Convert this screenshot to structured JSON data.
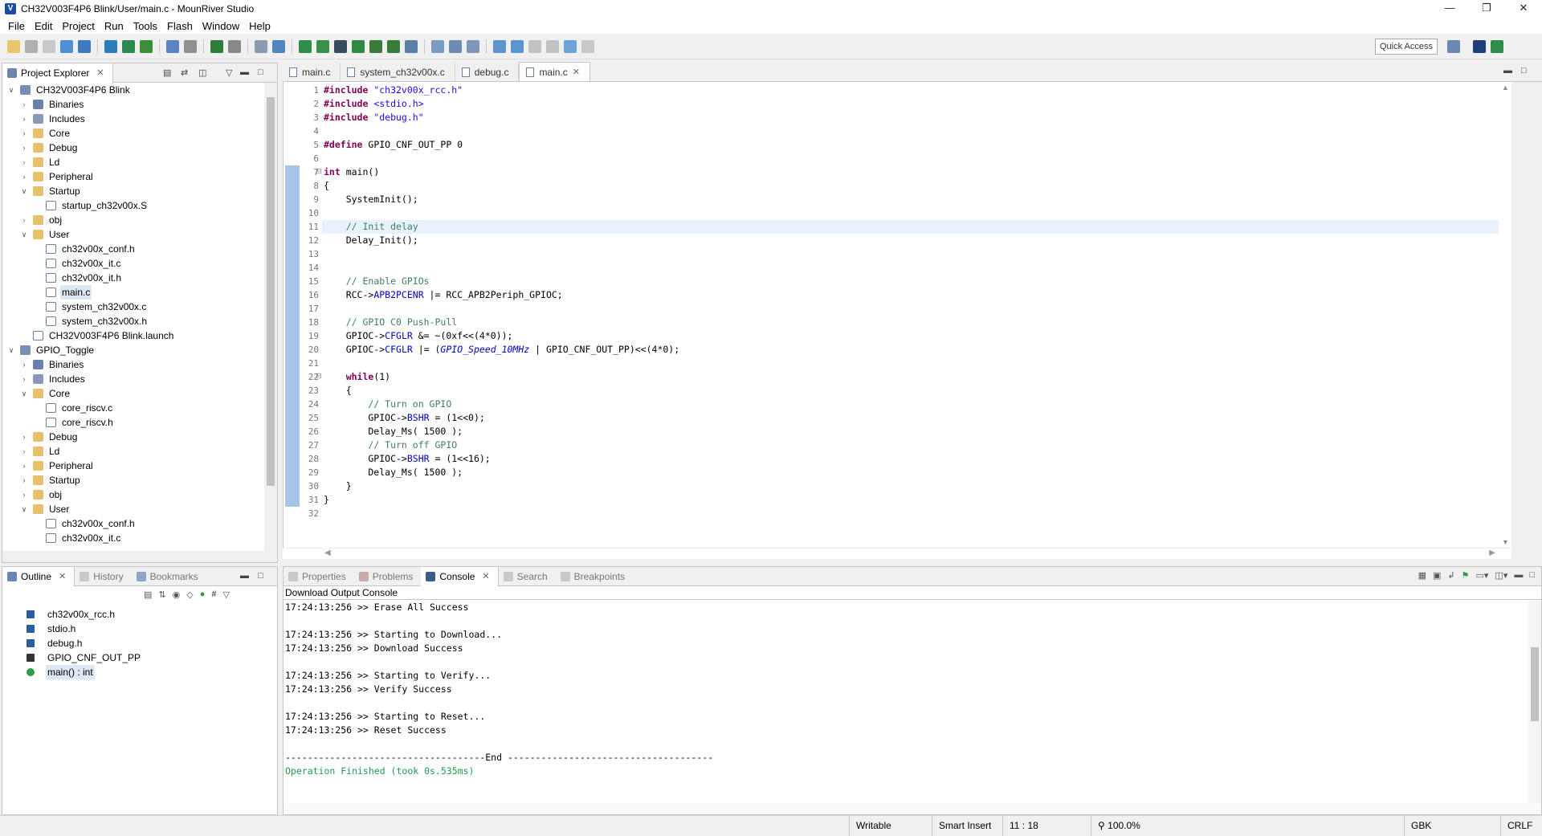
{
  "window": {
    "title": "CH32V003F4P6 Blink/User/main.c - MounRiver Studio"
  },
  "menu": [
    "File",
    "Edit",
    "Project",
    "Run",
    "Tools",
    "Flash",
    "Window",
    "Help"
  ],
  "quick_access": "Quick Access",
  "project_explorer": {
    "tab_label": "Project Explorer",
    "items": [
      {
        "label": "CH32V003F4P6 Blink",
        "depth": 0,
        "twisty": "v",
        "icon": "proj"
      },
      {
        "label": "Binaries",
        "depth": 1,
        "twisty": ">",
        "icon": "bin"
      },
      {
        "label": "Includes",
        "depth": 1,
        "twisty": ">",
        "icon": "inc"
      },
      {
        "label": "Core",
        "depth": 1,
        "twisty": ">",
        "icon": "fold"
      },
      {
        "label": "Debug",
        "depth": 1,
        "twisty": ">",
        "icon": "fold"
      },
      {
        "label": "Ld",
        "depth": 1,
        "twisty": ">",
        "icon": "fold"
      },
      {
        "label": "Peripheral",
        "depth": 1,
        "twisty": ">",
        "icon": "fold"
      },
      {
        "label": "Startup",
        "depth": 1,
        "twisty": "v",
        "icon": "fold"
      },
      {
        "label": "startup_ch32v00x.S",
        "depth": 2,
        "twisty": "",
        "icon": "file"
      },
      {
        "label": "obj",
        "depth": 1,
        "twisty": ">",
        "icon": "fold"
      },
      {
        "label": "User",
        "depth": 1,
        "twisty": "v",
        "icon": "fold"
      },
      {
        "label": "ch32v00x_conf.h",
        "depth": 2,
        "twisty": "",
        "icon": "file"
      },
      {
        "label": "ch32v00x_it.c",
        "depth": 2,
        "twisty": "",
        "icon": "file"
      },
      {
        "label": "ch32v00x_it.h",
        "depth": 2,
        "twisty": "",
        "icon": "file"
      },
      {
        "label": "main.c",
        "depth": 2,
        "twisty": "",
        "icon": "file",
        "selected": true
      },
      {
        "label": "system_ch32v00x.c",
        "depth": 2,
        "twisty": "",
        "icon": "file"
      },
      {
        "label": "system_ch32v00x.h",
        "depth": 2,
        "twisty": "",
        "icon": "file"
      },
      {
        "label": "CH32V003F4P6 Blink.launch",
        "depth": 1,
        "twisty": "",
        "icon": "file"
      },
      {
        "label": "GPIO_Toggle",
        "depth": 0,
        "twisty": "v",
        "icon": "proj"
      },
      {
        "label": "Binaries",
        "depth": 1,
        "twisty": ">",
        "icon": "bin"
      },
      {
        "label": "Includes",
        "depth": 1,
        "twisty": ">",
        "icon": "inc"
      },
      {
        "label": "Core",
        "depth": 1,
        "twisty": "v",
        "icon": "fold"
      },
      {
        "label": "core_riscv.c",
        "depth": 2,
        "twisty": "",
        "icon": "file"
      },
      {
        "label": "core_riscv.h",
        "depth": 2,
        "twisty": "",
        "icon": "file"
      },
      {
        "label": "Debug",
        "depth": 1,
        "twisty": ">",
        "icon": "fold"
      },
      {
        "label": "Ld",
        "depth": 1,
        "twisty": ">",
        "icon": "fold"
      },
      {
        "label": "Peripheral",
        "depth": 1,
        "twisty": ">",
        "icon": "fold"
      },
      {
        "label": "Startup",
        "depth": 1,
        "twisty": ">",
        "icon": "fold"
      },
      {
        "label": "obj",
        "depth": 1,
        "twisty": ">",
        "icon": "fold"
      },
      {
        "label": "User",
        "depth": 1,
        "twisty": "v",
        "icon": "fold"
      },
      {
        "label": "ch32v00x_conf.h",
        "depth": 2,
        "twisty": "",
        "icon": "file"
      },
      {
        "label": "ch32v00x_it.c",
        "depth": 2,
        "twisty": "",
        "icon": "file"
      }
    ]
  },
  "outline": {
    "tabs": [
      "Outline",
      "History",
      "Bookmarks"
    ],
    "items": [
      {
        "label": "ch32v00x_rcc.h",
        "icon": "include-icon"
      },
      {
        "label": "stdio.h",
        "icon": "include-icon"
      },
      {
        "label": "debug.h",
        "icon": "include-icon"
      },
      {
        "label": "GPIO_CNF_OUT_PP",
        "icon": "macro-icon"
      },
      {
        "label": "main() : int",
        "icon": "function-icon",
        "selected": true
      }
    ]
  },
  "editor": {
    "tabs": [
      {
        "label": "main.c",
        "active": false
      },
      {
        "label": "system_ch32v00x.c",
        "active": false
      },
      {
        "label": "debug.c",
        "active": false
      },
      {
        "label": "main.c",
        "active": true
      }
    ],
    "current_line": 11,
    "fold_lines": [
      7,
      22
    ],
    "lines": [
      [
        [
          "kw",
          "#include "
        ],
        [
          "str",
          "\"ch32v00x_rcc.h\""
        ]
      ],
      [
        [
          "kw",
          "#include "
        ],
        [
          "str",
          "<stdio.h>"
        ]
      ],
      [
        [
          "kw",
          "#include "
        ],
        [
          "str",
          "\"debug.h\""
        ]
      ],
      [],
      [
        [
          "kw",
          "#define "
        ],
        [
          "",
          "GPIO_CNF_OUT_PP 0"
        ]
      ],
      [],
      [
        [
          "kw",
          "int "
        ],
        [
          "",
          "main()"
        ]
      ],
      [
        [
          "",
          "{"
        ]
      ],
      [
        [
          "",
          "    SystemInit();"
        ]
      ],
      [],
      [
        [
          "",
          "    "
        ],
        [
          "cm",
          "// Init delay"
        ]
      ],
      [
        [
          "",
          "    Delay_Init();"
        ]
      ],
      [],
      [],
      [
        [
          "",
          "    "
        ],
        [
          "cm",
          "// Enable GPIOs"
        ]
      ],
      [
        [
          "",
          "    RCC->"
        ],
        [
          "fld",
          "APB2PCENR"
        ],
        [
          "",
          " |= RCC_APB2Periph_GPIOC;"
        ]
      ],
      [],
      [
        [
          "",
          "    "
        ],
        [
          "cm",
          "// GPIO C0 Push-Pull"
        ]
      ],
      [
        [
          "",
          "    GPIOC->"
        ],
        [
          "fld",
          "CFGLR"
        ],
        [
          "",
          " &= ~(0xf<<(4*0));"
        ]
      ],
      [
        [
          "",
          "    GPIOC->"
        ],
        [
          "fld",
          "CFGLR"
        ],
        [
          "",
          " |= ("
        ],
        [
          "mac",
          "GPIO_Speed_10MHz"
        ],
        [
          "",
          " | GPIO_CNF_OUT_PP)<<(4*0);"
        ]
      ],
      [],
      [
        [
          "",
          "    "
        ],
        [
          "kw",
          "while"
        ],
        [
          "",
          "(1)"
        ]
      ],
      [
        [
          "",
          "    {"
        ]
      ],
      [
        [
          "",
          "        "
        ],
        [
          "cm",
          "// Turn on GPIO"
        ]
      ],
      [
        [
          "",
          "        GPIOC->"
        ],
        [
          "fld",
          "BSHR"
        ],
        [
          "",
          " = (1<<0);"
        ]
      ],
      [
        [
          "",
          "        Delay_Ms( 1500 );"
        ]
      ],
      [
        [
          "",
          "        "
        ],
        [
          "cm",
          "// Turn off GPIO"
        ]
      ],
      [
        [
          "",
          "        GPIOC->"
        ],
        [
          "fld",
          "BSHR"
        ],
        [
          "",
          " = (1<<16);"
        ]
      ],
      [
        [
          "",
          "        Delay_Ms( 1500 );"
        ]
      ],
      [
        [
          "",
          "    }"
        ]
      ],
      [
        [
          "",
          "}"
        ]
      ],
      []
    ]
  },
  "bottom_panel": {
    "tabs": [
      "Properties",
      "Problems",
      "Console",
      "Search",
      "Breakpoints"
    ],
    "active_tab": "Console",
    "console_title": "Download Output Console",
    "lines": [
      "17:24:13:256 >> Erase All Success",
      "",
      "17:24:13:256 >> Starting to Download...",
      "17:24:13:256 >> Download Success",
      "",
      "17:24:13:256 >> Starting to Verify...",
      "17:24:13:256 >> Verify Success",
      "",
      "17:24:13:256 >> Starting to Reset...",
      "17:24:13:256 >> Reset Success",
      "",
      "------------------------------------End -------------------------------------"
    ],
    "finished": "Operation Finished (took 0s.535ms)"
  },
  "status": {
    "writable": "Writable",
    "insert_mode": "Smart Insert",
    "position": "11 : 18",
    "zoom": "100.0%",
    "encoding": "GBK",
    "line_ending": "CRLF"
  },
  "colors": {
    "accent": "#1a4fa0",
    "selection": "#dde8f5",
    "current_line": "#e8f2fe",
    "console_finished": "#1f9b52"
  }
}
